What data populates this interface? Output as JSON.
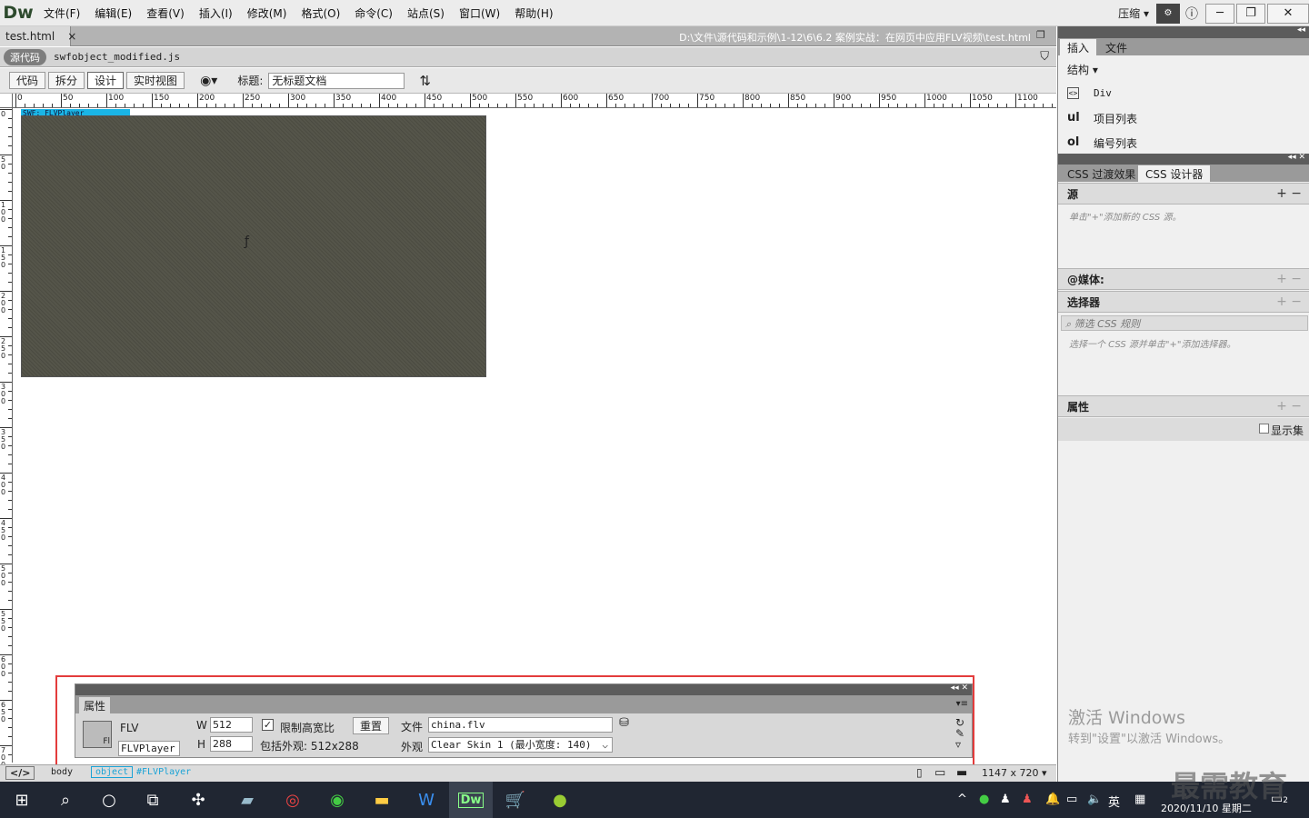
{
  "menubar": {
    "logo": "Dw",
    "items": [
      "文件(F)",
      "编辑(E)",
      "查看(V)",
      "插入(I)",
      "修改(M)",
      "格式(O)",
      "命令(C)",
      "站点(S)",
      "窗口(W)",
      "帮助(H)"
    ],
    "compress": "压缩",
    "sync_icon": "sync-icon"
  },
  "doctab": {
    "name": "test.html",
    "close": "×",
    "path": "D:\\文件\\源代码和示例\\1-12\\6\\6.2  案例实战：在网页中应用FLV视频\\test.html"
  },
  "related": {
    "source": "源代码",
    "file": "swfobject_modified.js"
  },
  "toolbar": {
    "code": "代码",
    "split": "拆分",
    "design": "设计",
    "live": "实时视图",
    "title_label": "标题:",
    "title_value": "无标题文档"
  },
  "ruler": {
    "h": [
      "0",
      "50",
      "100",
      "150",
      "200",
      "250",
      "300",
      "350",
      "400",
      "450",
      "500",
      "550",
      "600",
      "650",
      "700",
      "750",
      "800",
      "850",
      "900",
      "950",
      "1000",
      "1050",
      "1100"
    ],
    "v": [
      "0",
      "50",
      "100",
      "150",
      "200",
      "250",
      "300",
      "350",
      "400",
      "450",
      "500",
      "550",
      "600",
      "650",
      "700"
    ]
  },
  "design": {
    "tag": "SWF: FLVPlayer"
  },
  "props": {
    "tab": "属性",
    "type": "FLV",
    "id": "FLVPlayer",
    "w_label": "W",
    "w": "512",
    "h_label": "H",
    "h": "288",
    "constrain": "限制高宽比",
    "reset": "重置",
    "skin_size": "包括外观: 512x288",
    "file_label": "文件",
    "file": "china.flv",
    "skin_label": "外观",
    "skin": "Clear Skin 1 (最小宽度: 140)"
  },
  "status": {
    "tags": [
      "body",
      "object",
      "#FLVPlayer"
    ],
    "size": "1147 x 720"
  },
  "panel": {
    "tabs": [
      "插入",
      "文件"
    ],
    "structure": "结构",
    "items": [
      {
        "tag": "<>",
        "label": "Div"
      },
      {
        "tag": "ul",
        "label": "项目列表"
      },
      {
        "tag": "ol",
        "label": "编号列表"
      }
    ],
    "css_tabs": [
      "CSS 过渡效果",
      "CSS 设计器"
    ],
    "sources": "源",
    "sources_hint": "单击\"+\"添加新的 CSS 源。",
    "media": "@媒体:",
    "selectors": "选择器",
    "filter_placeholder": "筛选 CSS 规则",
    "selectors_hint": "选择一个 CSS 源并单击\"+\"添加选择器。",
    "properties": "属性",
    "show_set": "显示集"
  },
  "watermark": {
    "line1": "激活 Windows",
    "line2": "转到\"设置\"以激活 Windows。"
  },
  "taskbar": {
    "ime": "英",
    "date": "2020/11/10 星期二",
    "notify": "2",
    "brand": "最需教育"
  }
}
